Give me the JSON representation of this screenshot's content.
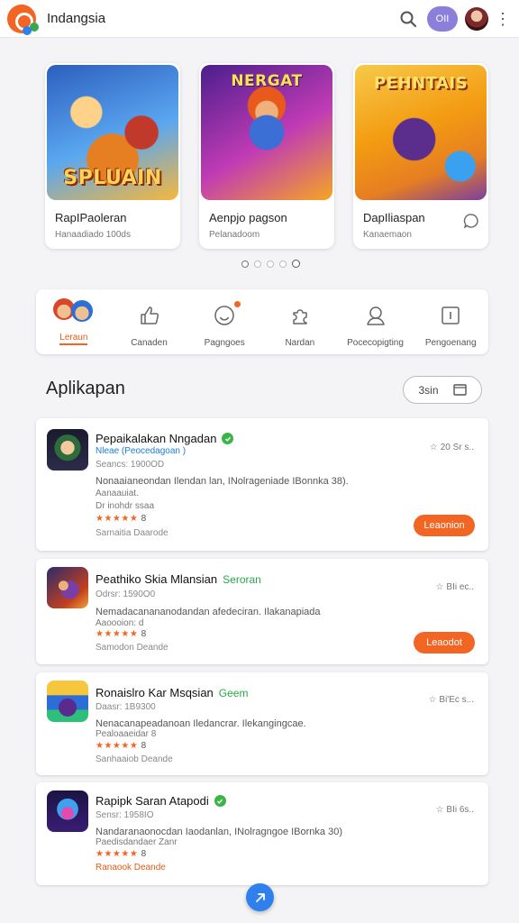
{
  "header": {
    "app_title": "Indangsia",
    "pill_label": "OII",
    "icons": [
      "search-icon",
      "user-avatar",
      "more-vert-icon"
    ]
  },
  "featured": [
    {
      "art_title": "SPLUAIN",
      "name": "RapIPaoleran",
      "sub": "Hanaadiado 100ds"
    },
    {
      "art_title": "NERGAT",
      "name": "Aenpjo pagson",
      "sub": "Pelanadoom"
    },
    {
      "art_title": "PEHNTAIS",
      "name": "DapIliaspan",
      "sub": "Kanaemaon"
    }
  ],
  "carousel": {
    "count": 5,
    "active": 4
  },
  "categories": [
    {
      "label": "Leraun",
      "icon": "game-characters-thumbnail",
      "active": true
    },
    {
      "label": "Canaden",
      "icon": "thumbs-up-icon"
    },
    {
      "label": "Pagngoes",
      "icon": "smiley-icon",
      "badge": true
    },
    {
      "label": "Nardan",
      "icon": "puzzle-icon"
    },
    {
      "label": "Pocecopigting",
      "icon": "user-icon"
    },
    {
      "label": "Pengoenang",
      "icon": "info-icon"
    }
  ],
  "section": {
    "title": "Aplikapan",
    "filter_label": "3sin"
  },
  "apps": [
    {
      "title": "Pepaikalakan Nngadan",
      "verified": true,
      "tag": "",
      "developer": "Nleae (Peocedagoan )",
      "meta": "Seancs: 1900OD",
      "description": "Nonaaianeondan Ilendan lan, INolrageniade IBonnka 38).",
      "description_extra": "Aanaauiat.",
      "sub_meta": "Dr inohdr ssaa",
      "stars": "★★★★★",
      "stars_count": "8",
      "rating": "20 Sr s..",
      "footer": "Sarnaitia  Daarode",
      "footer_orange": false,
      "cta": "Leaonion"
    },
    {
      "title": "Peathiko Skia Mlansian",
      "verified": false,
      "tag": "Seroran",
      "developer": "",
      "meta": "Odrsr: 1590O0",
      "description": "Nemadacanananodandan afedeciran. Ilakanapiada",
      "description_extra": "",
      "sub_meta": "Aaoooion: d",
      "stars": "★★★★★",
      "stars_count": "8",
      "rating": "BIi ec..",
      "footer": "Samodon  Deande",
      "footer_orange": false,
      "cta": "Leaodot"
    },
    {
      "title": "Ronaislro Kar Msqsian",
      "verified": false,
      "tag": "Geem",
      "developer": "",
      "meta": "Daasr: 1B9300",
      "description": "Nenacanapeadanoan Iledancrar. Ilekangingcae.",
      "description_extra": "",
      "sub_meta": "Pealoaaeidar 8",
      "stars": "★★★★★",
      "stars_count": "8",
      "rating": "Bi'Ec s...",
      "footer": "Sanhaaiob  Deande",
      "footer_orange": false,
      "cta": ""
    },
    {
      "title": "Rapipk Saran Atapodi",
      "verified": true,
      "tag": "",
      "developer": "",
      "meta": "Sensr: 1958IO",
      "description": "Nandaranaonocdan Iaodanlan, INolragngoe IBornka 30)",
      "description_extra": "",
      "sub_meta": "Paedisdandaer Zanr",
      "stars": "★★★★★",
      "stars_count": "8",
      "rating": "BIi 6s..",
      "footer": "Ranaook  Deande",
      "footer_orange": true,
      "cta": ""
    }
  ],
  "colors": {
    "accent": "#f26522",
    "link": "#1a7fd6",
    "verified": "#3bb54a",
    "fab": "#2f80ed"
  }
}
